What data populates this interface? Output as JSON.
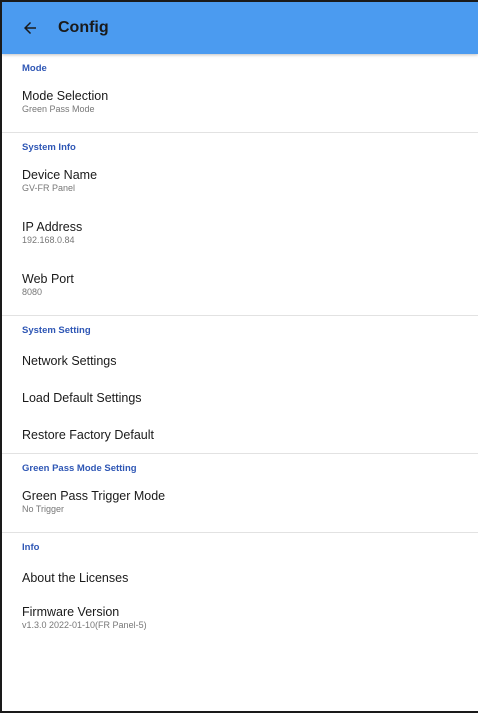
{
  "appbar": {
    "title": "Config",
    "back_icon": "arrow-left-icon"
  },
  "colors": {
    "appbar": "#4b9bf0",
    "section_header": "#2f57b5"
  },
  "sections": [
    {
      "header": "Mode",
      "items": [
        {
          "title": "Mode Selection",
          "subtitle": "Green Pass Mode"
        }
      ]
    },
    {
      "header": "System Info",
      "items": [
        {
          "title": "Device Name",
          "subtitle": "GV-FR Panel"
        },
        {
          "title": "IP Address",
          "subtitle": "192.168.0.84"
        },
        {
          "title": "Web Port",
          "subtitle": "8080"
        }
      ]
    },
    {
      "header": "System Setting",
      "items": [
        {
          "title": "Network Settings"
        },
        {
          "title": "Load Default Settings"
        },
        {
          "title": "Restore Factory Default"
        }
      ]
    },
    {
      "header": "Green Pass Mode Setting",
      "items": [
        {
          "title": "Green Pass Trigger Mode",
          "subtitle": "No Trigger"
        }
      ]
    },
    {
      "header": "Info",
      "items": [
        {
          "title": "About the Licenses"
        },
        {
          "title": "Firmware Version",
          "subtitle": "v1.3.0 2022-01-10(FR Panel-5)"
        }
      ]
    }
  ]
}
